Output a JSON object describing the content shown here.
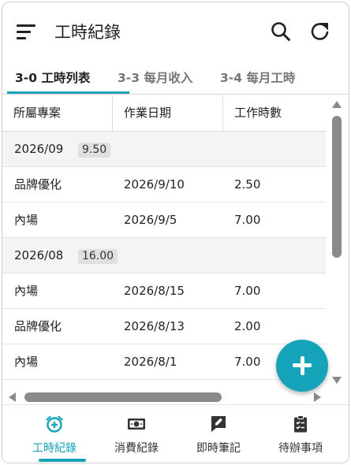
{
  "appbar": {
    "title": "工時紀錄",
    "menu_icon": "hamburger-menu-icon",
    "search_icon": "search-icon",
    "refresh_icon": "refresh-icon"
  },
  "tabs": [
    {
      "label": "3-0 工時列表",
      "active": true
    },
    {
      "label": "3-3 每月收入",
      "active": false
    },
    {
      "label": "3-4 每月工時",
      "active": false
    }
  ],
  "table": {
    "columns": [
      "所屬專案",
      "作業日期",
      "工作時數"
    ],
    "groups": [
      {
        "month": "2026/09",
        "total": "9.50",
        "rows": [
          [
            "品牌優化",
            "2026/9/10",
            "2.50"
          ],
          [
            "內場",
            "2026/9/5",
            "7.00"
          ]
        ]
      },
      {
        "month": "2026/08",
        "total": "16.00",
        "rows": [
          [
            "內場",
            "2026/8/15",
            "7.00"
          ],
          [
            "品牌優化",
            "2026/8/13",
            "2.00"
          ],
          [
            "內場",
            "2026/8/1",
            "7.00"
          ]
        ]
      }
    ]
  },
  "fab": {
    "icon": "plus-icon"
  },
  "bottom_nav": [
    {
      "label": "工時紀錄",
      "icon": "alarm-clock-add-icon",
      "active": true
    },
    {
      "label": "消費紀錄",
      "icon": "money-icon",
      "active": false
    },
    {
      "label": "即時筆記",
      "icon": "note-edit-icon",
      "active": false
    },
    {
      "label": "待辦事項",
      "icon": "clipboard-checklist-icon",
      "active": false
    }
  ],
  "colors": {
    "accent": "#14a3b8",
    "group_row_bg": "#f3f4f6",
    "badge_bg": "#dfe0e2",
    "scrollbar": "#8a8a8a"
  }
}
